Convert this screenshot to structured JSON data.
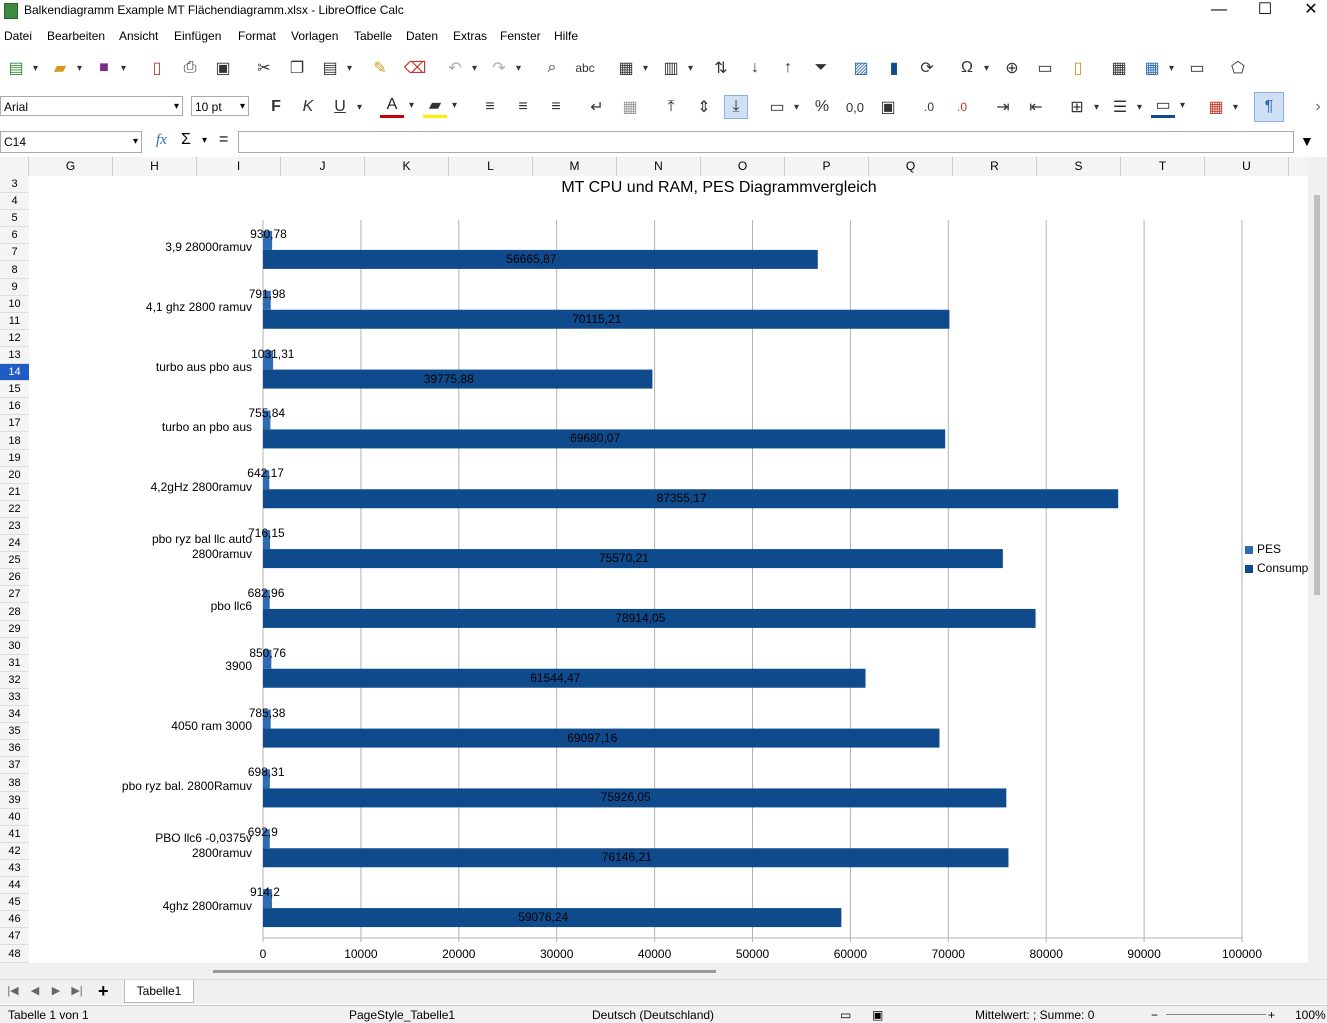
{
  "window": {
    "title": "Balkendiagramm Example MT Flächendiagramm.xlsx - LibreOffice Calc",
    "controls": [
      "—",
      "☐",
      "✕"
    ]
  },
  "menu": [
    "Datei",
    "Bearbeiten",
    "Ansicht",
    "Einfügen",
    "Format",
    "Vorlagen",
    "Tabelle",
    "Daten",
    "Extras",
    "Fenster",
    "Hilfe"
  ],
  "format_toolbar": {
    "font_name": "Arial",
    "font_size": "10 pt",
    "bold": "F",
    "italic": "K",
    "underline": "U",
    "percent": "%",
    "number": "0,0"
  },
  "formula_bar": {
    "name_box": "C14",
    "fx": "fx",
    "sum": "Σ",
    "equals": "=",
    "value": ""
  },
  "columns": [
    "G",
    "H",
    "I",
    "J",
    "K",
    "L",
    "M",
    "N",
    "O",
    "P",
    "Q",
    "R",
    "S",
    "T",
    "U"
  ],
  "rows": [
    "3",
    "4",
    "5",
    "6",
    "7",
    "8",
    "9",
    "10",
    "11",
    "12",
    "13",
    "14",
    "15",
    "16",
    "17",
    "18",
    "19",
    "20",
    "21",
    "22",
    "23",
    "24",
    "25",
    "26",
    "27",
    "28",
    "29",
    "30",
    "31",
    "32",
    "33",
    "34",
    "35",
    "36",
    "37",
    "38",
    "39",
    "40",
    "41",
    "42",
    "43",
    "44",
    "45",
    "46",
    "47",
    "48"
  ],
  "selected_row": "14",
  "sheet_tabs": [
    "Tabelle1"
  ],
  "statusbar": {
    "sheet": "Tabelle 1 von 1",
    "page_style": "PageStyle_Tabelle1",
    "language": "Deutsch (Deutschland)",
    "summary": "Mittelwert: ; Summe: 0",
    "zoom": "100%"
  },
  "colors": {
    "pes": "#2e6bb3",
    "consump": "#0f4b8c",
    "selected_row": "#1f5cc4"
  },
  "chart_data": {
    "type": "bar",
    "orientation": "horizontal",
    "title": "MT CPU und RAM, PES Diagrammvergleich",
    "categories": [
      "3,9 28000ramuv",
      "4,1 ghz 2800 ramuv",
      "turbo aus pbo aus",
      "turbo an pbo aus",
      "4,2gHz 2800ramuv",
      "pbo ryz bal llc auto\n2800ramuv",
      "pbo llc6",
      "3900",
      "4050 ram 3000",
      "pbo ryz bal. 2800Ramuv",
      "PBO llc6 -0,0375v\n2800ramuv",
      "4ghz 2800ramuv"
    ],
    "series": [
      {
        "name": "PES",
        "values": [
          930.78,
          791.98,
          1031.31,
          755.84,
          642.17,
          716.15,
          682.96,
          850.76,
          785.38,
          698.31,
          692.9,
          914.2
        ],
        "labels": [
          "930,78",
          "791,98",
          "1031,31",
          "755,84",
          "642,17",
          "716,15",
          "682,96",
          "850,76",
          "785,38",
          "698,31",
          "692,9",
          "914,2"
        ]
      },
      {
        "name": "Consump",
        "values": [
          56665.87,
          70115.21,
          39775.88,
          69680.07,
          87355.17,
          75570.21,
          78914.05,
          61544.47,
          69097.16,
          75926.05,
          76146.21,
          59076.24
        ],
        "labels": [
          "56665,87",
          "70115,21",
          "39775,88",
          "69680,07",
          "87355,17",
          "75570,21",
          "78914,05",
          "61544,47",
          "69097,16",
          "75926,05",
          "76146,21",
          "59076,24"
        ]
      }
    ],
    "xlim": [
      0,
      100000
    ],
    "xticks": [
      "0",
      "10000",
      "20000",
      "30000",
      "40000",
      "50000",
      "60000",
      "70000",
      "80000",
      "90000",
      "100000"
    ],
    "grid": true,
    "legend_position": "right"
  }
}
